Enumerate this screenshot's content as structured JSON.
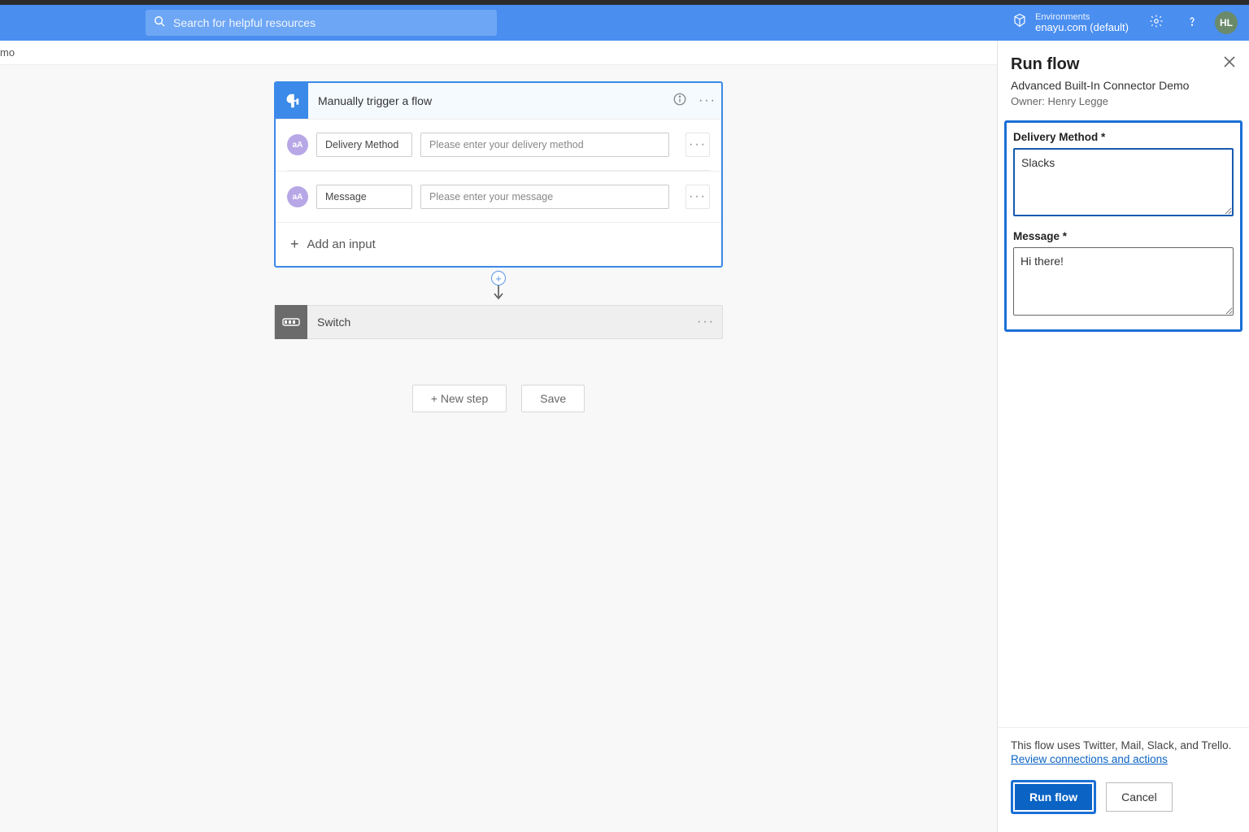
{
  "header": {
    "search_placeholder": "Search for helpful resources",
    "env_label": "Environments",
    "env_value": "enayu.com (default)",
    "avatar_initials": "HL"
  },
  "breadcrumb_fragment": "mo",
  "trigger": {
    "title": "Manually trigger a flow",
    "params": [
      {
        "icon": "aA",
        "name": "Delivery Method",
        "placeholder": "Please enter your delivery method"
      },
      {
        "icon": "aA",
        "name": "Message",
        "placeholder": "Please enter your message"
      }
    ],
    "add_input_label": "Add an input"
  },
  "switch": {
    "title": "Switch"
  },
  "buttons": {
    "new_step": "+ New step",
    "save": "Save"
  },
  "panel": {
    "title": "Run flow",
    "subtitle": "Advanced Built-In Connector Demo",
    "owner": "Owner: Henry Legge",
    "fields": {
      "delivery_label": "Delivery Method *",
      "delivery_value": "Slacks",
      "message_label": "Message *",
      "message_value": "Hi there!"
    },
    "footnote": "This flow uses Twitter, Mail, Slack, and Trello.",
    "review_link": "Review connections and actions",
    "run_label": "Run flow",
    "cancel_label": "Cancel"
  }
}
